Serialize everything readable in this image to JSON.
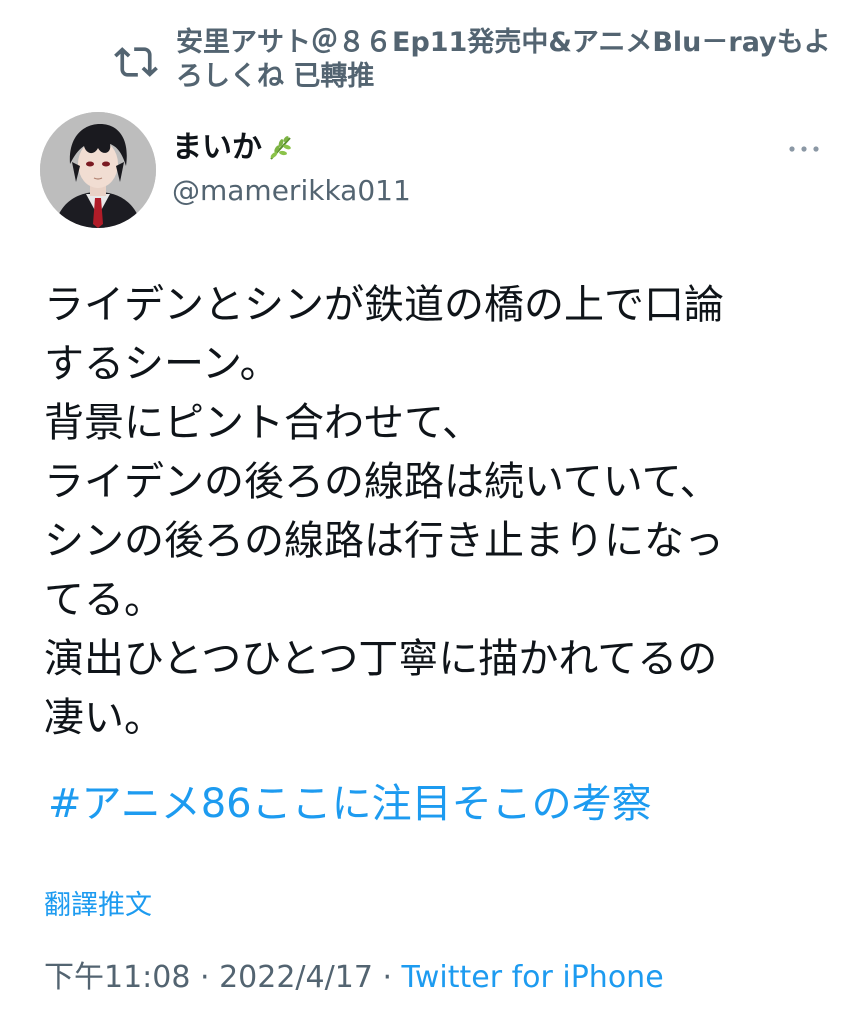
{
  "retweet": {
    "text": "安里アサト＠８６Ep11発売中&アニメBlu－rayもよろしくね 已轉推",
    "icon": "retweet-icon"
  },
  "author": {
    "display_name": "まいか",
    "name_emoji_icon": "leaf-icon",
    "handle": "@mamerikka011",
    "more_icon": "more-dots-icon"
  },
  "tweet": {
    "lines": [
      "ライデンとシンが鉄道の橋の上で口論",
      "するシーン。",
      "背景にピント合わせて、",
      "ライデンの後ろの線路は続いていて、",
      "シンの後ろの線路は行き止まりになっ",
      "てる。",
      "演出ひとつひとつ丁寧に描かれてるの",
      "凄い。"
    ],
    "hashtag": "#アニメ86ここに注目そこの考察"
  },
  "translate_label": "翻譯推文",
  "meta": {
    "time": "下午11:08",
    "separator_1": " · ",
    "date": "2022/4/17",
    "separator_2": " · ",
    "source": "Twitter for iPhone"
  },
  "colors": {
    "text": "#0f1419",
    "secondary": "#536471",
    "link": "#1d9bf0"
  }
}
